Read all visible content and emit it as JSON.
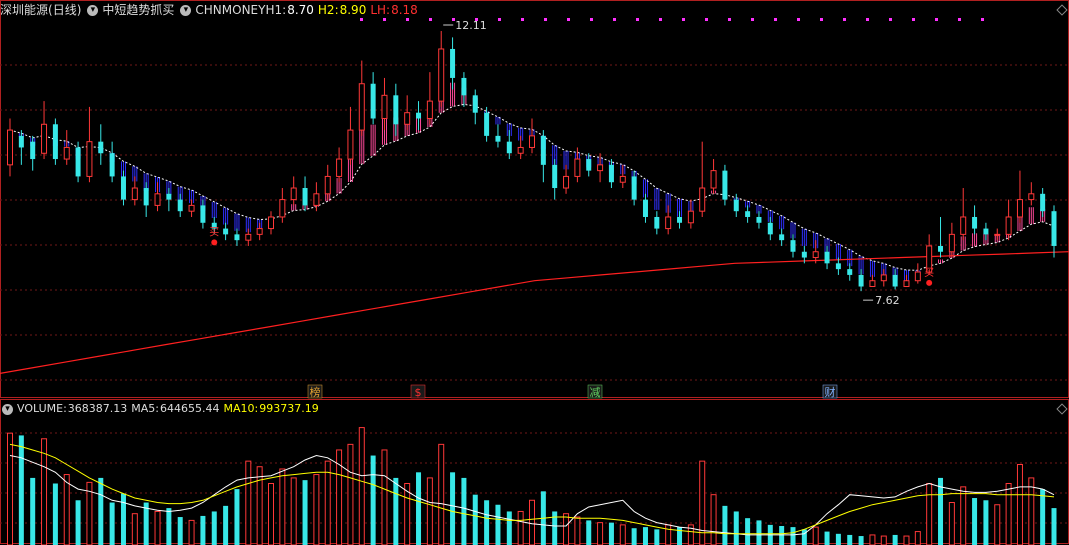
{
  "header": {
    "stock_name": "深圳能源",
    "period": "(日线)",
    "indicator_name": "中短趋势抓买",
    "h1_label": "CHNMONEYH1:",
    "h1_value": "8.70",
    "h2_label": "H2:",
    "h2_value": "8.90",
    "lh_label": "LH:",
    "lh_value": "8.18"
  },
  "volume_header": {
    "volume_label": "VOLUME:",
    "volume_value": "368387.13",
    "ma5_label": "MA5:",
    "ma5_value": "644655.44",
    "ma10_label": "MA10:",
    "ma10_value": "993737.19"
  },
  "markers": [
    {
      "label": "榜",
      "color": "#e0a030"
    },
    {
      "label": "$",
      "color": "#ff3030"
    },
    {
      "label": "减",
      "color": "#60d060"
    },
    {
      "label": "财",
      "color": "#7fb0ff"
    }
  ],
  "signals": {
    "buy_label": "买"
  },
  "colors": {
    "up": "#ff3838",
    "down": "#38e8e8",
    "ma_long": "#ff2020",
    "band_up": "#ff4a9a",
    "band_down": "#3030ff",
    "ma5": "#ffffff",
    "ma10": "#ffff00",
    "h1": "#ffffff",
    "h2": "#ffff00",
    "lh": "#ff3030"
  },
  "chart_data": {
    "type": "candlestick",
    "annotations": [
      {
        "label": "12.11",
        "value": 12.11,
        "kind": "high"
      },
      {
        "label": "7.62",
        "value": 7.62,
        "kind": "low"
      }
    ],
    "candles": [
      [
        9.8,
        10.4,
        10.6,
        9.6
      ],
      [
        10.3,
        10.1,
        10.4,
        9.8
      ],
      [
        10.2,
        9.9,
        10.3,
        9.7
      ],
      [
        10.0,
        10.5,
        10.9,
        9.9
      ],
      [
        10.5,
        9.9,
        10.6,
        9.8
      ],
      [
        9.9,
        10.1,
        10.4,
        9.8
      ],
      [
        10.1,
        9.6,
        10.2,
        9.5
      ],
      [
        9.6,
        10.2,
        10.8,
        9.5
      ],
      [
        10.2,
        10.0,
        10.5,
        9.8
      ],
      [
        10.0,
        9.6,
        10.2,
        9.5
      ],
      [
        9.6,
        9.2,
        9.7,
        9.1
      ],
      [
        9.2,
        9.4,
        9.6,
        9.1
      ],
      [
        9.4,
        9.1,
        9.5,
        8.9
      ],
      [
        9.1,
        9.3,
        9.5,
        9.0
      ],
      [
        9.3,
        9.2,
        9.4,
        9.0
      ],
      [
        9.2,
        9.0,
        9.3,
        8.9
      ],
      [
        9.0,
        9.1,
        9.2,
        8.9
      ],
      [
        9.1,
        8.8,
        9.2,
        8.7
      ],
      [
        8.8,
        8.7,
        8.9,
        8.6
      ],
      [
        8.7,
        8.6,
        8.8,
        8.5
      ],
      [
        8.6,
        8.5,
        8.7,
        8.4
      ],
      [
        8.5,
        8.6,
        8.7,
        8.4
      ],
      [
        8.6,
        8.7,
        8.8,
        8.5
      ],
      [
        8.7,
        8.9,
        9.0,
        8.6
      ],
      [
        8.9,
        9.2,
        9.4,
        8.8
      ],
      [
        9.2,
        9.4,
        9.6,
        9.1
      ],
      [
        9.4,
        9.1,
        9.6,
        9.0
      ],
      [
        9.1,
        9.3,
        9.5,
        9.0
      ],
      [
        9.3,
        9.6,
        9.8,
        9.2
      ],
      [
        9.6,
        9.9,
        10.1,
        9.5
      ],
      [
        9.9,
        10.4,
        10.8,
        9.8
      ],
      [
        10.4,
        11.2,
        11.6,
        10.3
      ],
      [
        11.2,
        10.6,
        11.4,
        10.5
      ],
      [
        10.6,
        11.0,
        11.3,
        10.4
      ],
      [
        11.0,
        10.5,
        11.2,
        10.3
      ],
      [
        10.5,
        10.7,
        11.0,
        10.4
      ],
      [
        10.7,
        10.6,
        10.9,
        10.4
      ],
      [
        10.6,
        10.9,
        11.4,
        10.5
      ],
      [
        10.9,
        11.8,
        12.11,
        10.8
      ],
      [
        11.8,
        11.3,
        12.0,
        11.1
      ],
      [
        11.3,
        11.0,
        11.4,
        10.8
      ],
      [
        11.0,
        10.7,
        11.1,
        10.5
      ],
      [
        10.7,
        10.3,
        10.8,
        10.2
      ],
      [
        10.3,
        10.2,
        10.5,
        10.1
      ],
      [
        10.2,
        10.0,
        10.4,
        9.9
      ],
      [
        10.0,
        10.1,
        10.3,
        9.9
      ],
      [
        10.1,
        10.3,
        10.6,
        10.0
      ],
      [
        10.3,
        9.8,
        10.4,
        9.5
      ],
      [
        9.8,
        9.4,
        9.9,
        9.2
      ],
      [
        9.4,
        9.6,
        9.8,
        9.3
      ],
      [
        9.6,
        9.9,
        10.1,
        9.5
      ],
      [
        9.9,
        9.7,
        10.0,
        9.6
      ],
      [
        9.7,
        9.8,
        10.0,
        9.5
      ],
      [
        9.8,
        9.5,
        9.9,
        9.4
      ],
      [
        9.5,
        9.6,
        9.8,
        9.4
      ],
      [
        9.6,
        9.2,
        9.7,
        9.1
      ],
      [
        9.2,
        8.9,
        9.3,
        8.8
      ],
      [
        8.9,
        8.7,
        9.0,
        8.6
      ],
      [
        8.7,
        8.9,
        9.1,
        8.6
      ],
      [
        8.9,
        8.8,
        9.0,
        8.7
      ],
      [
        8.8,
        9.0,
        9.2,
        8.7
      ],
      [
        9.0,
        9.4,
        10.2,
        8.9
      ],
      [
        9.4,
        9.7,
        9.9,
        9.3
      ],
      [
        9.7,
        9.2,
        9.8,
        9.1
      ],
      [
        9.2,
        9.0,
        9.3,
        8.9
      ],
      [
        9.0,
        8.9,
        9.1,
        8.8
      ],
      [
        8.9,
        8.8,
        9.0,
        8.7
      ],
      [
        8.8,
        8.6,
        8.9,
        8.5
      ],
      [
        8.6,
        8.5,
        8.7,
        8.4
      ],
      [
        8.5,
        8.3,
        8.6,
        8.2
      ],
      [
        8.3,
        8.2,
        8.4,
        8.1
      ],
      [
        8.2,
        8.3,
        8.5,
        8.1
      ],
      [
        8.3,
        8.1,
        8.4,
        8.0
      ],
      [
        8.1,
        8.0,
        8.2,
        7.9
      ],
      [
        8.0,
        7.9,
        8.1,
        7.8
      ],
      [
        7.9,
        7.7,
        8.0,
        7.62
      ],
      [
        7.7,
        7.8,
        7.9,
        7.7
      ],
      [
        7.8,
        7.9,
        8.0,
        7.7
      ],
      [
        7.9,
        7.7,
        8.0,
        7.65
      ],
      [
        7.7,
        7.8,
        7.9,
        7.7
      ],
      [
        7.8,
        7.95,
        8.1,
        7.75
      ],
      [
        7.95,
        8.4,
        8.6,
        7.9
      ],
      [
        8.4,
        8.3,
        8.9,
        8.2
      ],
      [
        8.3,
        8.6,
        8.8,
        8.2
      ],
      [
        8.6,
        8.9,
        9.4,
        8.5
      ],
      [
        8.9,
        8.7,
        9.1,
        8.6
      ],
      [
        8.7,
        8.6,
        8.8,
        8.5
      ],
      [
        8.6,
        8.6,
        8.7,
        8.5
      ],
      [
        8.6,
        8.9,
        9.2,
        8.5
      ],
      [
        8.9,
        9.2,
        9.7,
        8.8
      ],
      [
        9.2,
        9.3,
        9.5,
        9.1
      ],
      [
        9.3,
        9.0,
        9.4,
        8.9
      ],
      [
        9.0,
        8.4,
        9.1,
        8.2
      ]
    ],
    "volume": {
      "values": [
        1.0,
        0.98,
        0.6,
        0.95,
        0.55,
        0.63,
        0.4,
        0.56,
        0.6,
        0.38,
        0.46,
        0.28,
        0.38,
        0.3,
        0.33,
        0.25,
        0.22,
        0.26,
        0.3,
        0.35,
        0.5,
        0.75,
        0.7,
        0.55,
        0.68,
        0.6,
        0.58,
        0.63,
        0.75,
        0.85,
        0.9,
        1.05,
        0.8,
        0.85,
        0.6,
        0.55,
        0.65,
        0.6,
        0.9,
        0.65,
        0.6,
        0.45,
        0.4,
        0.36,
        0.3,
        0.3,
        0.4,
        0.48,
        0.3,
        0.28,
        0.25,
        0.22,
        0.2,
        0.2,
        0.18,
        0.15,
        0.16,
        0.14,
        0.18,
        0.16,
        0.18,
        0.75,
        0.45,
        0.35,
        0.3,
        0.24,
        0.22,
        0.18,
        0.17,
        0.16,
        0.14,
        0.16,
        0.12,
        0.1,
        0.09,
        0.08,
        0.09,
        0.08,
        0.09,
        0.08,
        0.12,
        0.55,
        0.6,
        0.38,
        0.52,
        0.42,
        0.4,
        0.36,
        0.55,
        0.72,
        0.6,
        0.5,
        0.33
      ],
      "ma5": [
        0.8,
        0.78,
        0.74,
        0.7,
        0.65,
        0.56,
        0.5,
        0.48,
        0.45,
        0.4,
        0.38,
        0.35,
        0.33,
        0.31,
        0.3,
        0.31,
        0.33,
        0.38,
        0.45,
        0.52,
        0.58,
        0.6,
        0.61,
        0.62,
        0.66,
        0.7,
        0.76,
        0.8,
        0.78,
        0.72,
        0.65,
        0.62,
        0.63,
        0.62,
        0.55,
        0.48,
        0.42,
        0.38,
        0.37,
        0.35,
        0.33,
        0.3,
        0.27,
        0.25,
        0.23,
        0.21,
        0.19,
        0.18,
        0.17,
        0.17,
        0.28,
        0.34,
        0.36,
        0.38,
        0.4,
        0.3,
        0.24,
        0.2,
        0.18,
        0.16,
        0.15,
        0.13,
        0.12,
        0.11,
        0.1,
        0.09,
        0.09,
        0.09,
        0.09,
        0.09,
        0.1,
        0.18,
        0.28,
        0.36,
        0.45,
        0.44,
        0.43,
        0.42,
        0.43,
        0.48,
        0.52,
        0.55,
        0.52,
        0.5,
        0.48,
        0.47,
        0.47,
        0.48,
        0.5,
        0.52,
        0.52,
        0.5,
        0.45
      ],
      "ma10": [
        0.9,
        0.88,
        0.85,
        0.82,
        0.78,
        0.72,
        0.66,
        0.6,
        0.55,
        0.5,
        0.46,
        0.42,
        0.4,
        0.38,
        0.37,
        0.37,
        0.38,
        0.4,
        0.44,
        0.48,
        0.52,
        0.55,
        0.58,
        0.6,
        0.62,
        0.63,
        0.64,
        0.65,
        0.65,
        0.63,
        0.6,
        0.57,
        0.54,
        0.5,
        0.46,
        0.42,
        0.39,
        0.36,
        0.33,
        0.3,
        0.28,
        0.26,
        0.24,
        0.23,
        0.22,
        0.22,
        0.23,
        0.24,
        0.25,
        0.25,
        0.24,
        0.24,
        0.24,
        0.23,
        0.22,
        0.2,
        0.18,
        0.16,
        0.14,
        0.13,
        0.12,
        0.11,
        0.11,
        0.1,
        0.1,
        0.1,
        0.1,
        0.1,
        0.1,
        0.11,
        0.14,
        0.18,
        0.22,
        0.26,
        0.3,
        0.33,
        0.36,
        0.38,
        0.4,
        0.42,
        0.44,
        0.45,
        0.45,
        0.46,
        0.46,
        0.46,
        0.46,
        0.45,
        0.45,
        0.45,
        0.45,
        0.44,
        0.43
      ]
    },
    "ma_long": [
      6.2,
      6.3,
      6.4,
      6.5,
      6.6,
      6.7,
      6.8,
      6.9,
      7.0,
      7.1,
      7.2,
      7.3,
      7.4,
      7.5,
      7.6,
      7.7,
      7.8,
      7.85,
      7.9,
      7.95,
      8.0,
      8.05,
      8.1,
      8.12,
      8.14,
      8.16,
      8.18,
      8.2,
      8.22,
      8.24,
      8.26,
      8.28,
      8.3
    ],
    "y_range": [
      6.0,
      12.3
    ]
  }
}
